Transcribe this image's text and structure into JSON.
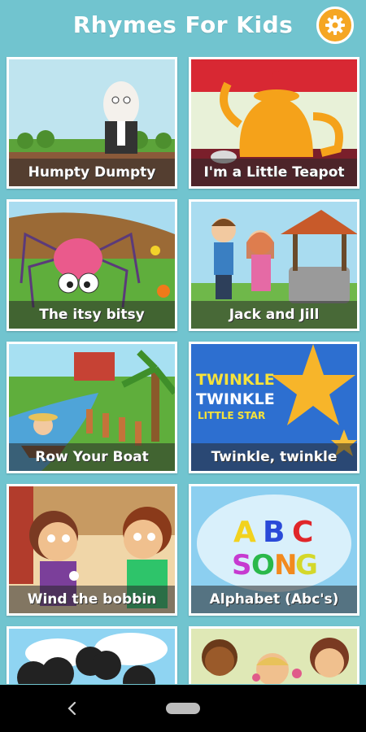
{
  "app": {
    "title": "Rhymes For Kids",
    "settings_icon": "gear-icon"
  },
  "rhymes": [
    {
      "label": "Humpty Dumpty"
    },
    {
      "label": "I'm a Little Teapot"
    },
    {
      "label": "The itsy bitsy"
    },
    {
      "label": "Jack and Jill"
    },
    {
      "label": "Row Your Boat"
    },
    {
      "label": "Twinkle, twinkle",
      "art_text": "TWINKLE TWINKLE LITTLE STAR"
    },
    {
      "label": "Wind the bobbin"
    },
    {
      "label": "Alphabet (Abc's)",
      "art_text": [
        "A",
        "B",
        "C",
        "SONG"
      ]
    },
    {
      "label": ""
    },
    {
      "label": ""
    }
  ],
  "navbar": {
    "back_icon": "back-icon",
    "home_icon": "home-pill-icon"
  },
  "colors": {
    "background": "#71c4cf",
    "settings_button": "#f5a623",
    "navbar": "#000000"
  }
}
